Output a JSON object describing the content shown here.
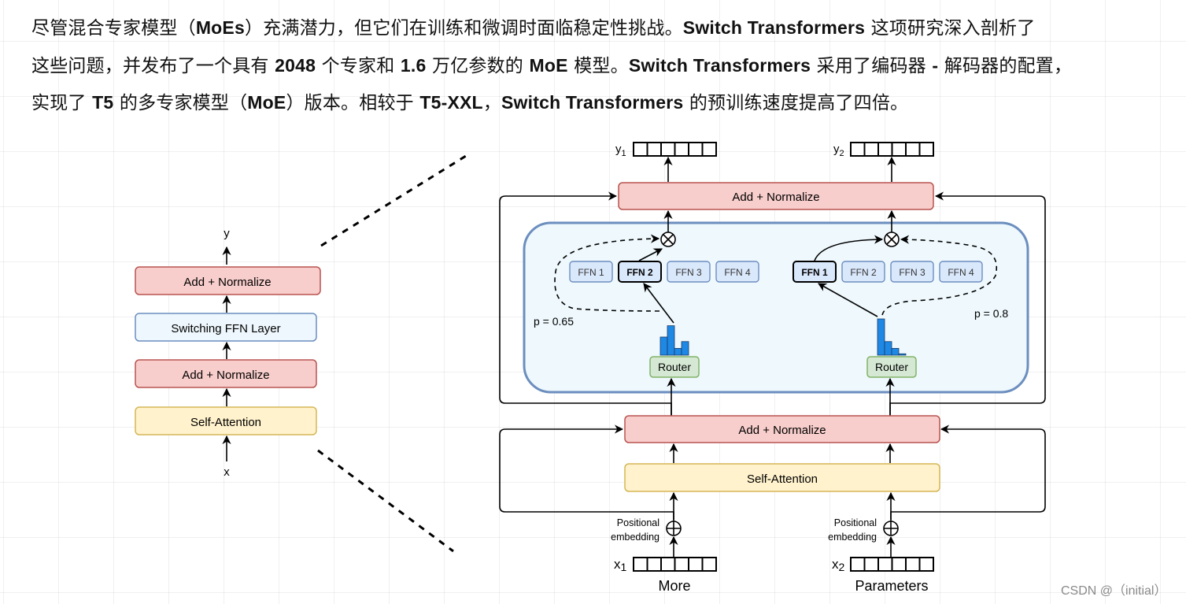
{
  "paragraph": {
    "lines": [
      [
        {
          "t": "尽管混合专家模型（",
          "latin": false
        },
        {
          "t": "MoEs",
          "latin": true
        },
        {
          "t": "）充满潜力，但它们在训练和微调时面临稳定性挑战。",
          "latin": false
        },
        {
          "t": "Switch Transformers",
          "latin": true
        },
        {
          "t": " 这项研究深入剖析了",
          "latin": false
        }
      ],
      [
        {
          "t": "这些问题，并发布了一个具有 ",
          "latin": false
        },
        {
          "t": "2048",
          "latin": true
        },
        {
          "t": " 个专家和 ",
          "latin": false
        },
        {
          "t": "1.6",
          "latin": true
        },
        {
          "t": " 万亿参数的 ",
          "latin": false
        },
        {
          "t": "MoE",
          "latin": true
        },
        {
          "t": " 模型。",
          "latin": false
        },
        {
          "t": "Switch Transformers",
          "latin": true
        },
        {
          "t": " 采用了编码器 ",
          "latin": false
        },
        {
          "t": "-",
          "latin": true
        },
        {
          "t": " 解码器的配置，",
          "latin": false
        }
      ],
      [
        {
          "t": "实现了 ",
          "latin": false
        },
        {
          "t": "T5",
          "latin": true
        },
        {
          "t": " 的多专家模型（",
          "latin": false
        },
        {
          "t": "MoE",
          "latin": true
        },
        {
          "t": "）版本。相较于 ",
          "latin": false
        },
        {
          "t": "T5-XXL",
          "latin": true
        },
        {
          "t": "，",
          "latin": false
        },
        {
          "t": "Switch Transformers",
          "latin": true
        },
        {
          "t": " 的预训练速度提高了四倍。",
          "latin": false
        }
      ]
    ]
  },
  "colors": {
    "add_norm_fill": "#f8cecc",
    "add_norm_stroke": "#b85450",
    "ffn_layer_fill": "#eef7fd",
    "ffn_layer_stroke": "#6c8ebf",
    "self_attn_fill": "#fff2cc",
    "self_attn_stroke": "#d6b656",
    "moe_panel_fill": "#eef8fd",
    "moe_panel_stroke": "#6c8ebf",
    "expert_fill": "#dae8fc",
    "expert_stroke": "#6c8ebf",
    "router_fill": "#d5e8d4",
    "router_stroke": "#82b366",
    "histogram_bar": "#1e88e5"
  },
  "left_block": {
    "output_label": "y",
    "input_label": "x",
    "layers": [
      "Add + Normalize",
      "Switching FFN Layer",
      "Add + Normalize",
      "Self-Attention"
    ]
  },
  "right_block": {
    "top_add_norm": "Add + Normalize",
    "bottom_add_norm": "Add + Normalize",
    "self_attention": "Self-Attention",
    "tokens": [
      {
        "output_label": "y",
        "output_sub": "1",
        "input_label": "x",
        "input_sub": "1",
        "word": "More",
        "positional_label_1": "Positional",
        "positional_label_2": "embedding",
        "experts": [
          "FFN 1",
          "FFN 2",
          "FFN 3",
          "FFN 4"
        ],
        "selected_expert": 2,
        "router_label": "Router",
        "probability_label": "p = 0.65",
        "router_distribution": [
          0.4,
          0.65,
          0.15,
          0.3
        ]
      },
      {
        "output_label": "y",
        "output_sub": "2",
        "input_label": "x",
        "input_sub": "2",
        "word": "Parameters",
        "positional_label_1": "Positional",
        "positional_label_2": "embedding",
        "experts": [
          "FFN 1",
          "FFN 2",
          "FFN 3",
          "FFN 4"
        ],
        "selected_expert": 1,
        "router_label": "Router",
        "probability_label": "p = 0.8",
        "router_distribution": [
          0.8,
          0.3,
          0.15,
          0.03
        ]
      }
    ]
  },
  "watermark": "CSDN @（initial）"
}
